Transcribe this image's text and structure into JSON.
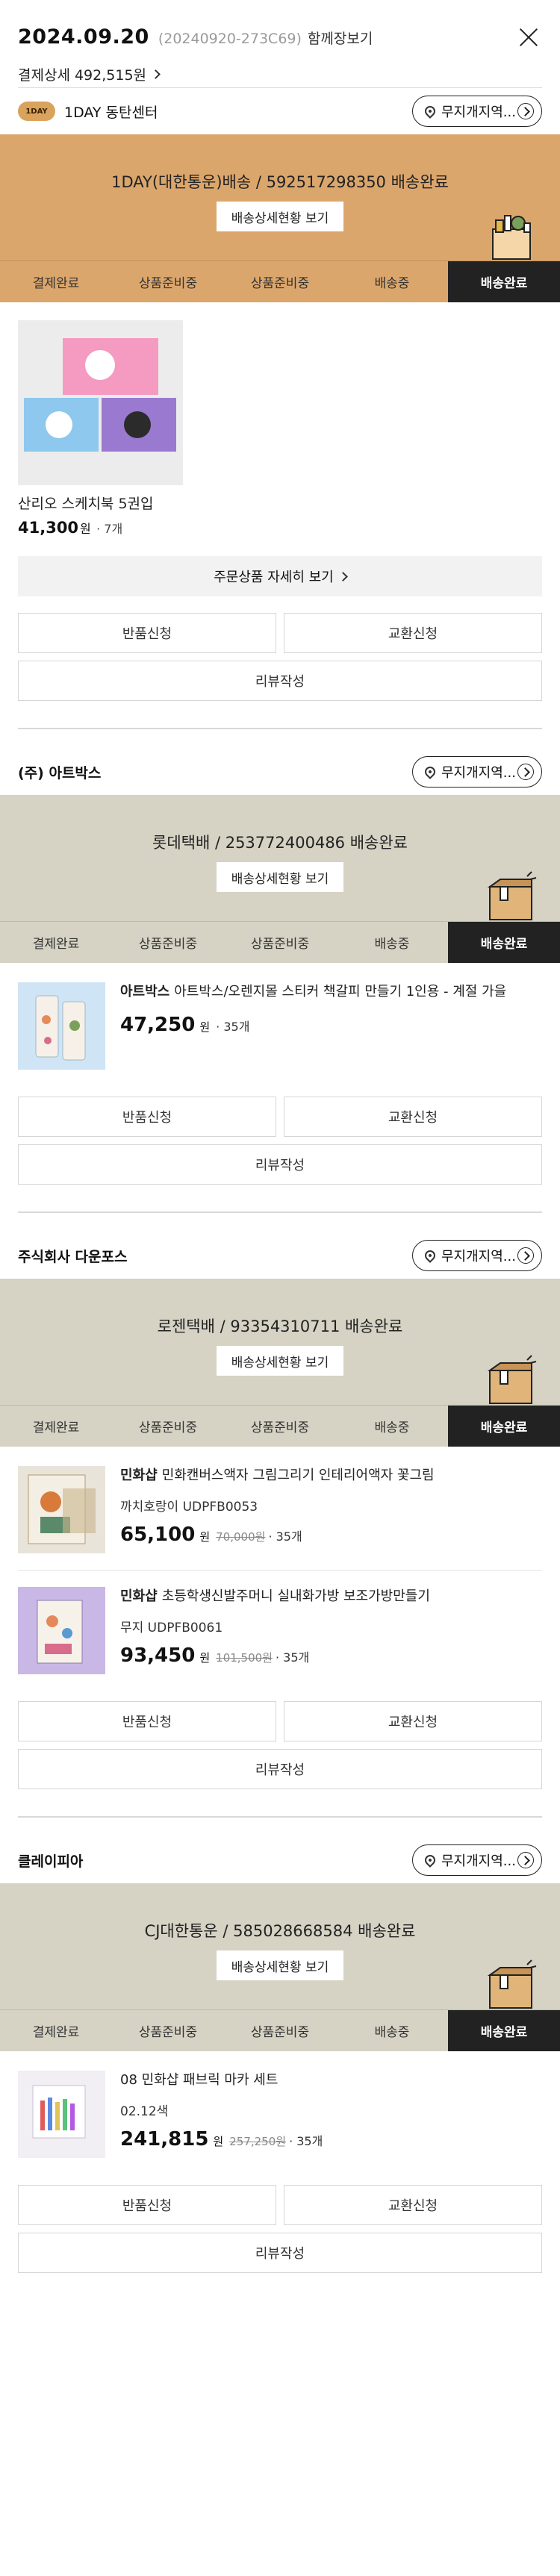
{
  "header": {
    "date": "2024.09.20",
    "order_no": "(20240920-273C69)",
    "together_label": "함께장보기",
    "pay_detail": "결제상세 492,515원"
  },
  "common": {
    "nomu_label": "무지개지역...",
    "track_label": "배송상세현황 보기",
    "steps": [
      "결제완료",
      "상품준비중",
      "상품준비중",
      "배송중",
      "배송완료"
    ],
    "detail_label": "주문상품 자세히 보기",
    "return_label": "반품신청",
    "exchange_label": "교환신청",
    "review_label": "리뷰작성"
  },
  "sellers": [
    {
      "name": "1DAY 동탄센터",
      "logo_text": "1DAY",
      "carrier": "1DAY(대한통운)배송 / 592517298350 배송완료",
      "banner_color": "#dba66c",
      "card": {
        "title": "산리오 스케치북 5권입",
        "price": "41,300",
        "won": "원",
        "qty": "· 7개"
      }
    },
    {
      "name": "(주) 아트박스",
      "carrier": "롯데택배 / 253772400486 배송완료",
      "banner_color": "#d6d2c4",
      "items": [
        {
          "brand": "아트박스",
          "title": "아트박스/오렌지몰 스티커 책갈피 만들기 1인용 - 계절 가을",
          "option": "",
          "price": "47,250",
          "won": "원",
          "orig": "",
          "qty": "· 35개"
        }
      ]
    },
    {
      "name": "주식회사 다운포스",
      "carrier": "로젠택배 / 93354310711 배송완료",
      "banner_color": "#d6d2c4",
      "items": [
        {
          "brand": "민화샵",
          "title": "민화캔버스액자 그림그리기 인테리어액자 꽃그림",
          "option": "까치호랑이 UDPFB0053",
          "price": "65,100",
          "won": "원",
          "orig": "70,000원",
          "qty": "· 35개"
        },
        {
          "brand": "민화샵",
          "title": "초등학생신발주머니 실내화가방 보조가방만들기",
          "option": "무지 UDPFB0061",
          "price": "93,450",
          "won": "원",
          "orig": "101,500원",
          "qty": "· 35개"
        }
      ]
    },
    {
      "name": "클레이피아",
      "carrier": "CJ대한통운 / 585028668584 배송완료",
      "banner_color": "#d6d2c4",
      "items": [
        {
          "brand": "",
          "title": "08 민화샵 패브릭 마카 세트",
          "option": "02.12색",
          "price": "241,815",
          "won": "원",
          "orig": "257,250원",
          "qty": "· 35개"
        }
      ]
    }
  ]
}
